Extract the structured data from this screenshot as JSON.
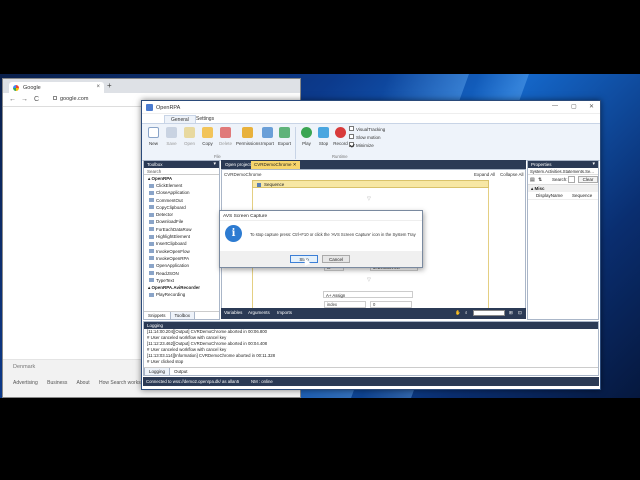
{
  "browser": {
    "tab_title": "Google",
    "tab_close": "×",
    "new_tab": "+",
    "nav_back": "←",
    "nav_forward": "→",
    "nav_reload": "C",
    "url": "google.com",
    "footer_country": "Denmark",
    "footer_links": [
      "Advertising",
      "Business",
      "About",
      "How Search works"
    ]
  },
  "app": {
    "title": "OpenRPA",
    "window_controls": [
      "—",
      "▢",
      "✕"
    ],
    "ribbon_tabs": [
      "General",
      "Settings"
    ],
    "file_buttons": [
      "New",
      "Save",
      "Open",
      "Copy",
      "Delete",
      "Permissions",
      "Import",
      "Export"
    ],
    "file_group": "File",
    "run_buttons": [
      "Play",
      "Stop",
      "Record"
    ],
    "run_group": "Runtime",
    "checkboxes": [
      {
        "label": "VisualTracking",
        "checked": false
      },
      {
        "label": "Slow motion",
        "checked": false
      },
      {
        "label": "Minimize",
        "checked": true
      }
    ]
  },
  "toolbox": {
    "title": "Toolbox",
    "search": "Search",
    "category1": "OpenRPA",
    "items": [
      "ClickElement",
      "CloseApplication",
      "CommentOut",
      "CopyClipboard",
      "Detector",
      "DownloadFile",
      "ForEachDataRow",
      "HighlightElement",
      "InsertClipboard",
      "InvokeOpenFlow",
      "InvokeOpenRPA",
      "OpenApplication",
      "ReadJSON",
      "TypeText"
    ],
    "category2": "OpenRPA.AviRecorder",
    "items2": [
      "PlayRecording"
    ],
    "tabs": [
      "Snippets",
      "Toolbox"
    ]
  },
  "designer": {
    "tabs": [
      "Open project",
      "CVRDemoChrome ✕"
    ],
    "breadcrumb": "CVRDemoChrome",
    "expand_all": "Expand All",
    "collapse_all": "Collapse All",
    "sequence": "Sequence",
    "ghost_activity": "ReadRange",
    "ghost_field": "Password",
    "ghost_field_value": "\"SAS\"DEFAULT\"",
    "field_left": "to",
    "field_right": "dt.DefaultView",
    "assign": "Assign",
    "assign_to": "index",
    "assign_value": "0",
    "bottom_tabs": [
      "Variables",
      "Arguments",
      "Imports"
    ]
  },
  "properties": {
    "title": "Properties",
    "type": "System.Activities.Statements.Se...",
    "search_label": "Search:",
    "clear": "Clear",
    "category": "Misc",
    "rows": [
      {
        "key": "DisplayName",
        "value": "Sequence"
      }
    ]
  },
  "logging": {
    "title": "Logging",
    "lines": [
      "[11:14:00.204][Output] CVRDemoChrome aborted in 00:06.800",
      "# User canceled workflow with cancel key",
      "[11:12:23.462][Output] CVRDemoChrome aborted in 00:04.408",
      "# User canceled workflow with cancel key",
      "[11:13:03.114][Information] CVRDemoChrome aborted in 00:11.328",
      "# User clicked stop"
    ],
    "tabs": [
      "Logging",
      "Output"
    ]
  },
  "status": {
    "connection": "Connected to wss://demo2.openrpa.dk/ as allan5",
    "nm": "NM : online"
  },
  "dialog": {
    "title": "AVS Screen Capture",
    "icon": "i",
    "message": "To stop capture press: Ctrl+F10 or click the 'AVS Screen Capture' icon in the System Tray",
    "ok": "Stop",
    "cancel": "Cancel"
  },
  "colors": {
    "accent": "#2b3a55",
    "sequence": "#f7e7a4",
    "play": "#3aa552",
    "stop": "#4aa6e0",
    "record": "#d83b3b"
  }
}
